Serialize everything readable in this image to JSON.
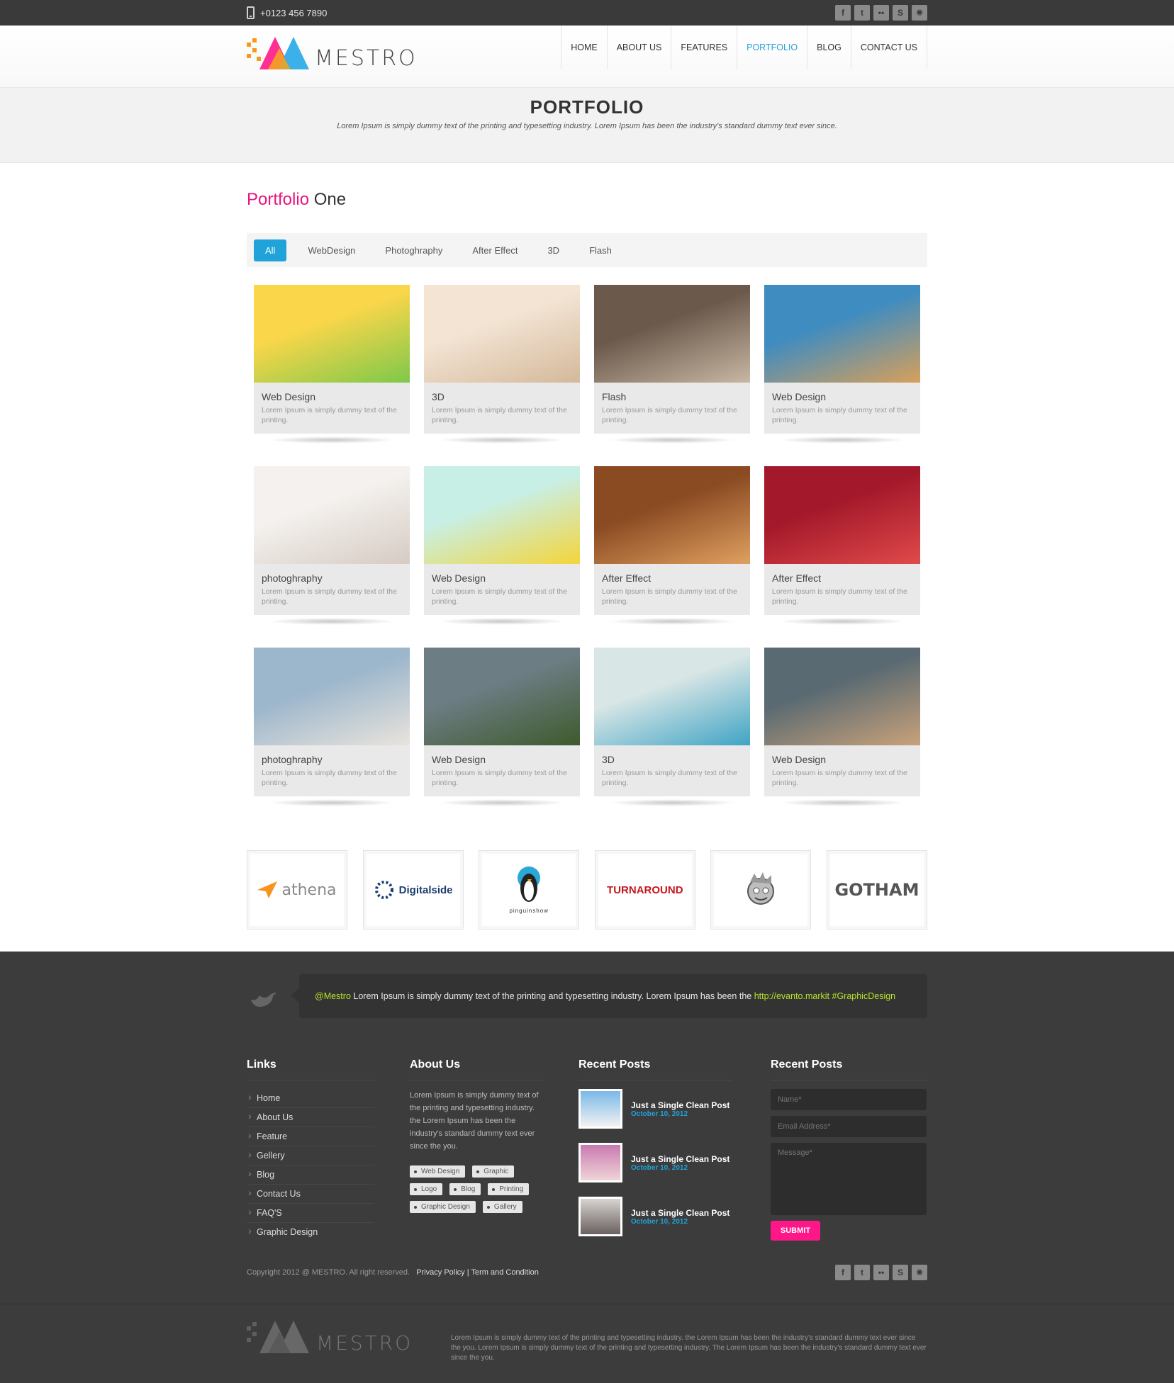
{
  "topbar": {
    "phone": "+0123 456 7890"
  },
  "social": [
    "f",
    "t",
    "••",
    "S",
    "✺"
  ],
  "brand": {
    "name": "MESTRO"
  },
  "nav": [
    {
      "label": "HOME",
      "active": false
    },
    {
      "label": "ABOUT US",
      "active": false
    },
    {
      "label": "FEATURES",
      "active": false
    },
    {
      "label": "PORTFOLIO",
      "active": true
    },
    {
      "label": "BLOG",
      "active": false
    },
    {
      "label": "CONTACT US",
      "active": false
    }
  ],
  "page": {
    "title": "PORTFOLIO",
    "subtitle": "Lorem Ipsum is simply dummy text of the printing and typesetting industry. Lorem Ipsum has been the industry's standard dummy text ever since.",
    "section_title_accent": "Portfolio",
    "section_title_rest": " One"
  },
  "filters": [
    {
      "label": "All",
      "active": true
    },
    {
      "label": "WebDesign",
      "active": false
    },
    {
      "label": "Photoghraphy",
      "active": false
    },
    {
      "label": "After Effect",
      "active": false
    },
    {
      "label": "3D",
      "active": false
    },
    {
      "label": "Flash",
      "active": false
    }
  ],
  "portfolio": [
    {
      "title": "Web Design",
      "desc": "Lorem Ipsum is simply dummy text of the printing.",
      "colors": [
        "#f9d64a",
        "#7ec84a"
      ]
    },
    {
      "title": "3D",
      "desc": "Lorem Ipsum is simply dummy text of the printing.",
      "colors": [
        "#f3e4d4",
        "#d4b99a"
      ]
    },
    {
      "title": "Flash",
      "desc": "Lorem Ipsum is simply dummy text of the printing.",
      "colors": [
        "#6b5a4c",
        "#c9b7a4"
      ]
    },
    {
      "title": "Web Design",
      "desc": "Lorem Ipsum is simply dummy text of the printing.",
      "colors": [
        "#3f8cc0",
        "#d8a05a"
      ]
    },
    {
      "title": "photoghraphy",
      "desc": "Lorem Ipsum is simply dummy text of the printing.",
      "colors": [
        "#f4f1ee",
        "#d6cbc3"
      ]
    },
    {
      "title": "Web Design",
      "desc": "Lorem Ipsum is simply dummy text of the printing.",
      "colors": [
        "#c8efe6",
        "#f4d53a"
      ]
    },
    {
      "title": "After Effect",
      "desc": "Lorem Ipsum is simply dummy text of the printing.",
      "colors": [
        "#8a4a22",
        "#e0a060"
      ]
    },
    {
      "title": "After Effect",
      "desc": "Lorem Ipsum is simply dummy text of the printing.",
      "colors": [
        "#a3182a",
        "#e04a4a"
      ]
    },
    {
      "title": "photoghraphy",
      "desc": "Lorem Ipsum is simply dummy text of the printing.",
      "colors": [
        "#9cb6cc",
        "#e9e4dc"
      ]
    },
    {
      "title": "Web Design",
      "desc": "Lorem Ipsum is simply dummy text of the printing.",
      "colors": [
        "#6d7d84",
        "#3e5a2c"
      ]
    },
    {
      "title": "3D",
      "desc": "Lorem Ipsum is simply dummy text of the printing.",
      "colors": [
        "#d9e6e6",
        "#3fa4c4"
      ]
    },
    {
      "title": "Web Design",
      "desc": "Lorem Ipsum is simply dummy text of the printing.",
      "colors": [
        "#5a6a72",
        "#c9a27a"
      ]
    }
  ],
  "clients": [
    {
      "name": "athena",
      "icon": "paper-plane",
      "color": "#f7941d"
    },
    {
      "name": "Digitalside",
      "icon": "dotted-ring",
      "color": "#1c3e6e"
    },
    {
      "name": "pinguinshow",
      "icon": "penguin",
      "color": "#222222"
    },
    {
      "name": "TURNAROUND",
      "icon": "wordmark",
      "color": "#c4161c"
    },
    {
      "name": "",
      "icon": "mascot-face",
      "color": "#777777"
    },
    {
      "name": "GOTHAM",
      "icon": "wordmark",
      "color": "#555555"
    }
  ],
  "tweet": {
    "handle": "@Mestro",
    "text": " Lorem Ipsum is simply dummy text of the printing and typesetting industry. Lorem Ipsum has been the ",
    "link": "http://evanto.markit",
    "hashtag": " #GraphicDesign"
  },
  "footer": {
    "links_title": "Links",
    "links": [
      "Home",
      "About Us",
      "Feature",
      "Gellery",
      "Blog",
      "Contact Us",
      "FAQ'S",
      "Graphic Design"
    ],
    "about_title": "About Us",
    "about_text": "Lorem Ipsum is simply dummy text of the printing and typesetting industry. the Lorem Ipsum has been the industry's standard dummy text ever since the you.",
    "tags": [
      "Web Design",
      "Graphic",
      "Logo",
      "Blog",
      "Printing",
      "Graphic Design",
      "Gallery"
    ],
    "posts_title": "Recent Posts",
    "posts": [
      {
        "title": "Just a Single Clean Post",
        "date": "October 10, 2012",
        "colors": [
          "#7ab8e8",
          "#f2f2f2"
        ]
      },
      {
        "title": "Just a Single Clean Post",
        "date": "October 10, 2012",
        "colors": [
          "#c87ab0",
          "#f0d4d8"
        ]
      },
      {
        "title": "Just a Single Clean Post",
        "date": "October 10, 2012",
        "colors": [
          "#d8d4d0",
          "#6a6060"
        ]
      }
    ],
    "form_title": "Recent Posts",
    "form": {
      "name_ph": "Name*",
      "email_ph": "Email Address*",
      "message_ph": "Message*",
      "submit": "SUBMIT"
    },
    "copyright": "Copyright 2012 @ MESTRO. All right reserved.",
    "privacy": "Privacy Policy",
    "sep": " | ",
    "terms": "Term and Condition",
    "desc": "Lorem Ipsum is simply dummy text of the printing and typesetting industry. the Lorem Ipsum has been the industry's standard dummy text ever since the you. Lorem Ipsum is simply dummy text of the printing and typesetting industry. The Lorem Ipsum has been the industry's standard dummy text ever since the you."
  },
  "colors": {
    "accent_blue": "#1fa3d8",
    "accent_pink": "#e8157d",
    "footer_bg": "#3c3c3c",
    "tweet_green": "#b6e52a"
  }
}
